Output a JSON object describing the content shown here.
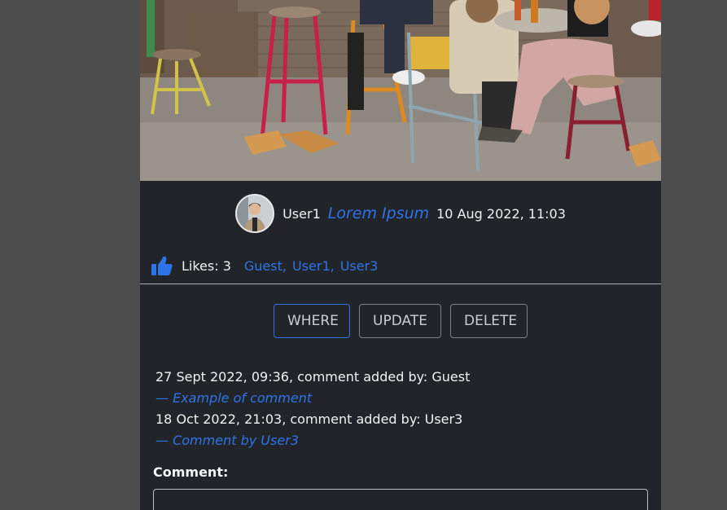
{
  "post": {
    "author": "User1",
    "title": "Lorem Ipsum",
    "date": "10 Aug 2022, 11:03"
  },
  "likes": {
    "label": "Likes: 3",
    "users": [
      "Guest,",
      "User1,",
      "User3"
    ]
  },
  "actions": {
    "where": "WHERE",
    "update": "UPDATE",
    "delete": "DELETE"
  },
  "comments": [
    {
      "meta": "27 Sept 2022, 09:36, comment added by: Guest",
      "text": "— Example of comment"
    },
    {
      "meta": "18 Oct 2022, 21:03, comment added by: User3",
      "text": "— Comment by User3"
    }
  ],
  "comment_form": {
    "label": "Comment:",
    "value": ""
  },
  "colors": {
    "background": "#4d4d4d",
    "card": "#212529",
    "accent": "#2f73e8"
  },
  "icons": {
    "like": "thumbs-up-icon"
  }
}
